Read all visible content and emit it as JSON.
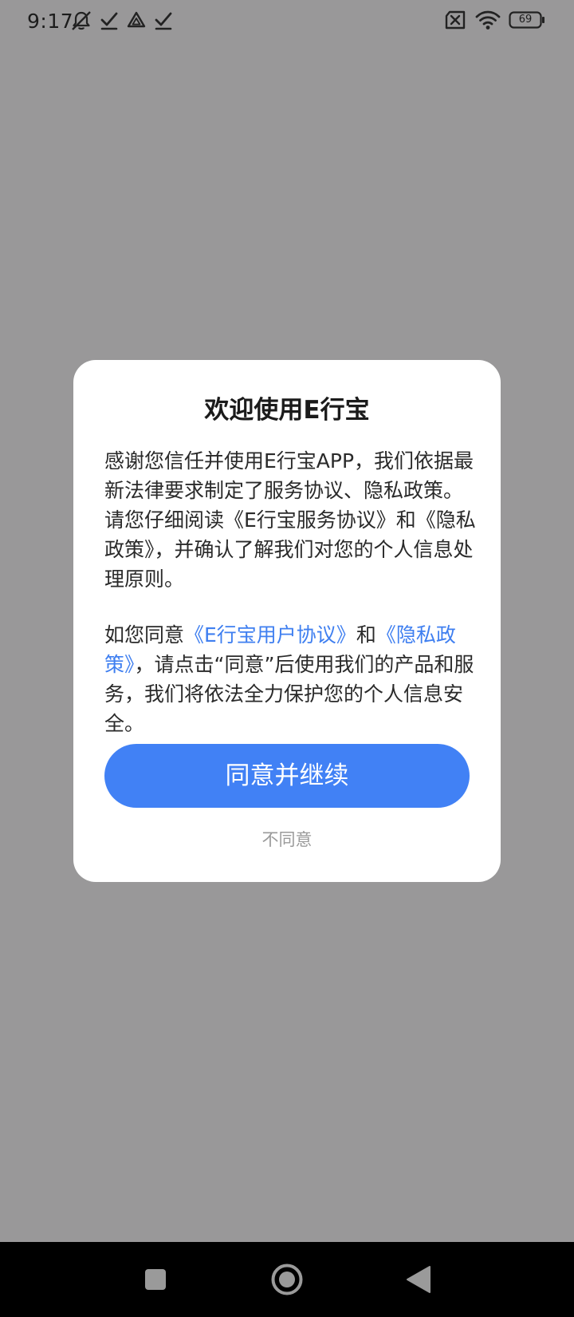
{
  "status_bar": {
    "time": "9:17",
    "left_icons": [
      "notifications-off-icon",
      "check-icon",
      "drive-icon",
      "check-icon"
    ],
    "right_icons": [
      "sim-disabled-icon",
      "wifi-icon",
      "battery-icon"
    ],
    "battery_level": "69"
  },
  "dialog": {
    "title": "欢迎使用E行宝",
    "paragraph1": "感谢您信任并使用E行宝APP，我们依据最新法律要求制定了服务协议、隐私政策。请您仔细阅读《E行宝服务协议》和《隐私政策》，并确认了解我们对您的个人信息处理原则。",
    "paragraph2": {
      "prefix": "如您同意",
      "link_user_agreement": "《E行宝用户协议》",
      "middle": "和",
      "link_privacy_policy": "《隐私政策》",
      "suffix": "，请点击“同意”后使用我们的产品和服务，我们将依法全力保护您的个人信息安全。"
    },
    "agree_button": "同意并继续",
    "disagree_button": "不同意"
  },
  "nav_bar": {
    "buttons": [
      "recents-icon",
      "home-icon",
      "back-icon"
    ]
  },
  "colors": {
    "overlay": "#999899",
    "dialog_bg": "#ffffff",
    "accent": "#4181f5",
    "link": "#3f7ff0",
    "muted": "#9a9a9a"
  }
}
